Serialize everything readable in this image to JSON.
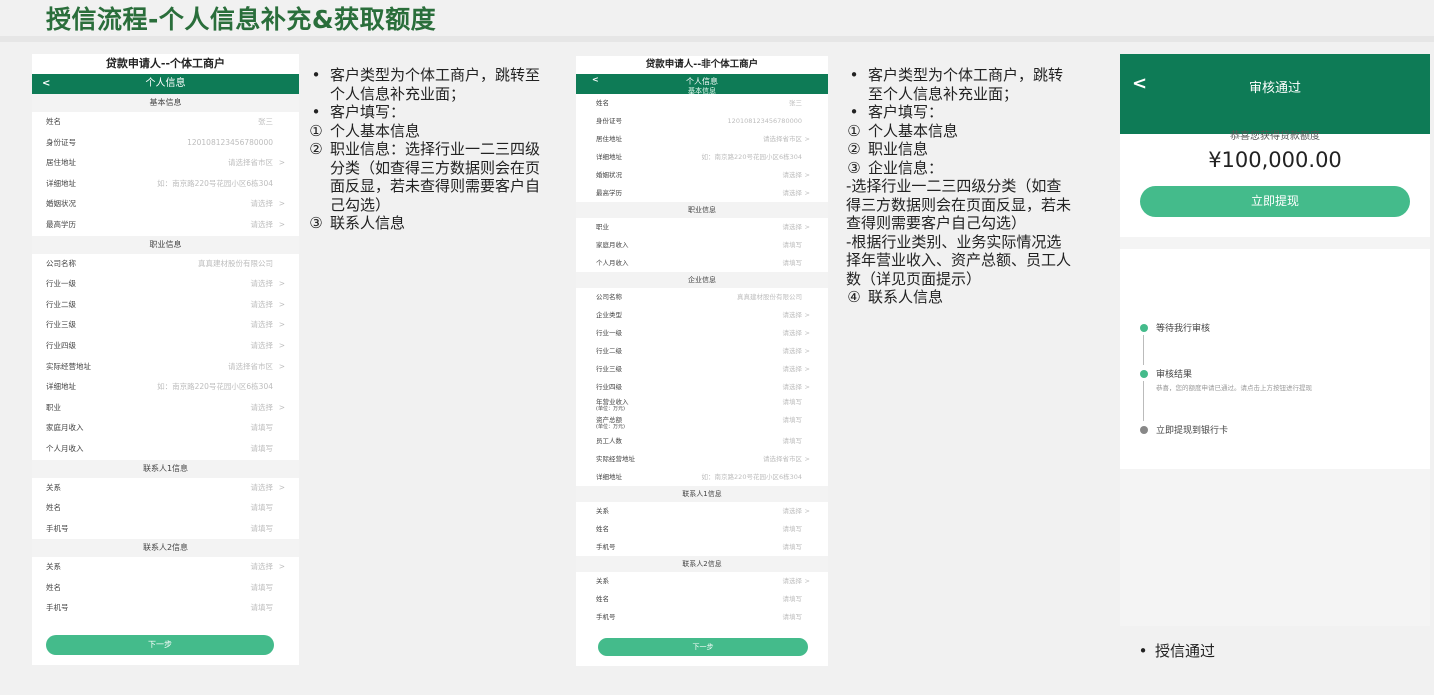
{
  "slide": {
    "title": "授信流程-个人信息补充&获取额度"
  },
  "phone1": {
    "title": "贷款申请人--个体工商户",
    "header": "个人信息",
    "back": "<",
    "sections": [
      {
        "title": "基本信息",
        "rows": [
          {
            "label": "姓名",
            "value": "张三",
            "arrow": ""
          },
          {
            "label": "身份证号",
            "value": "120108123456780000",
            "arrow": ""
          },
          {
            "label": "居住地址",
            "value": "请选择省市区",
            "arrow": ">"
          },
          {
            "label": "详细地址",
            "value": "如：南京路220号花园小区6栋304",
            "arrow": ""
          },
          {
            "label": "婚姻状况",
            "value": "请选择",
            "arrow": ">"
          },
          {
            "label": "最高学历",
            "value": "请选择",
            "arrow": ">"
          }
        ]
      },
      {
        "title": "职业信息",
        "rows": [
          {
            "label": "公司名称",
            "value": "真真建材股份有限公司",
            "arrow": ""
          },
          {
            "label": "行业一级",
            "value": "请选择",
            "arrow": ">"
          },
          {
            "label": "行业二级",
            "value": "请选择",
            "arrow": ">"
          },
          {
            "label": "行业三级",
            "value": "请选择",
            "arrow": ">"
          },
          {
            "label": "行业四级",
            "value": "请选择",
            "arrow": ">"
          },
          {
            "label": "实际经营地址",
            "value": "请选择省市区",
            "arrow": ">"
          },
          {
            "label": "详细地址",
            "value": "如：南京路220号花园小区6栋304",
            "arrow": ""
          },
          {
            "label": "职业",
            "value": "请选择",
            "arrow": ">"
          },
          {
            "label": "家庭月收入",
            "value": "请填写",
            "arrow": ""
          },
          {
            "label": "个人月收入",
            "value": "请填写",
            "arrow": ""
          }
        ]
      },
      {
        "title": "联系人1信息",
        "rows": [
          {
            "label": "关系",
            "value": "请选择",
            "arrow": ">"
          },
          {
            "label": "姓名",
            "value": "请填写",
            "arrow": ""
          },
          {
            "label": "手机号",
            "value": "请填写",
            "arrow": ""
          }
        ]
      },
      {
        "title": "联系人2信息",
        "rows": [
          {
            "label": "关系",
            "value": "请选择",
            "arrow": ">"
          },
          {
            "label": "姓名",
            "value": "请填写",
            "arrow": ""
          },
          {
            "label": "手机号",
            "value": "请填写",
            "arrow": ""
          }
        ]
      }
    ],
    "button": "下一步"
  },
  "note1": {
    "lines": [
      {
        "bullet": "•",
        "text": "客户类型为个体工商户，跳转至"
      },
      {
        "bullet": "",
        "text": "个人信息补充业面；"
      },
      {
        "bullet": "•",
        "text": "客户填写："
      },
      {
        "bullet": "①",
        "text": "个人基本信息"
      },
      {
        "bullet": "②",
        "text": "职业信息：选择行业一二三四级"
      },
      {
        "bullet": "",
        "text": "分类（如查得三方数据则会在页"
      },
      {
        "bullet": "",
        "text": "面反显，若未查得则需要客户自"
      },
      {
        "bullet": "",
        "text": "己勾选）"
      },
      {
        "bullet": "③",
        "text": "联系人信息"
      }
    ]
  },
  "phone2": {
    "title": "贷款申请人--非个体工商户",
    "header": "个人信息",
    "header_sub": "基本信息",
    "back": "<",
    "sections": [
      {
        "title": "",
        "rows": [
          {
            "label": "姓名",
            "value": "张三",
            "arrow": ""
          },
          {
            "label": "身份证号",
            "value": "120108123456780000",
            "arrow": ""
          },
          {
            "label": "居住地址",
            "value": "请选择省市区",
            "arrow": ">"
          },
          {
            "label": "详细地址",
            "value": "如：南京路220号花园小区6栋304",
            "arrow": ""
          },
          {
            "label": "婚姻状况",
            "value": "请选择",
            "arrow": ">"
          },
          {
            "label": "最高学历",
            "value": "请选择",
            "arrow": ">"
          }
        ]
      },
      {
        "title": "职业信息",
        "rows": [
          {
            "label": "职业",
            "value": "请选择",
            "arrow": ">"
          },
          {
            "label": "家庭月收入",
            "value": "请填写",
            "arrow": ""
          },
          {
            "label": "个人月收入",
            "value": "请填写",
            "arrow": ""
          }
        ]
      },
      {
        "title": "企业信息",
        "rows": [
          {
            "label": "公司名称",
            "value": "真真建材股份有限公司",
            "arrow": ""
          },
          {
            "label": "企业类型",
            "value": "请选择",
            "arrow": ">"
          },
          {
            "label": "行业一级",
            "value": "请选择",
            "arrow": ">"
          },
          {
            "label": "行业二级",
            "value": "请选择",
            "arrow": ">"
          },
          {
            "label": "行业三级",
            "value": "请选择",
            "arrow": ">"
          },
          {
            "label": "行业四级",
            "value": "请选择",
            "arrow": ">"
          },
          {
            "label": "年营业收入",
            "label2": "(单位：万元)",
            "value": "请填写",
            "arrow": ""
          },
          {
            "label": "资产总额",
            "label2": "(单位：万元)",
            "value": "请填写",
            "arrow": ""
          },
          {
            "label": "员工人数",
            "value": "请填写",
            "arrow": ""
          },
          {
            "label": "实际经营地址",
            "value": "请选择省市区",
            "arrow": ">"
          },
          {
            "label": "详细地址",
            "value": "如：南京路220号花园小区6栋304",
            "arrow": ""
          }
        ]
      },
      {
        "title": "联系人1信息",
        "rows": [
          {
            "label": "关系",
            "value": "请选择",
            "arrow": ">"
          },
          {
            "label": "姓名",
            "value": "请填写",
            "arrow": ""
          },
          {
            "label": "手机号",
            "value": "请填写",
            "arrow": ""
          }
        ]
      },
      {
        "title": "联系人2信息",
        "rows": [
          {
            "label": "关系",
            "value": "请选择",
            "arrow": ">"
          },
          {
            "label": "姓名",
            "value": "请填写",
            "arrow": ""
          },
          {
            "label": "手机号",
            "value": "请填写",
            "arrow": ""
          }
        ]
      }
    ],
    "button": "下一步"
  },
  "note2": {
    "lines": [
      {
        "bullet": "•",
        "text": "客户类型为个体工商户，跳转"
      },
      {
        "bullet": "",
        "text": "至个人信息补充业面；"
      },
      {
        "bullet": "•",
        "text": "客户填写："
      },
      {
        "bullet": "①",
        "text": "个人基本信息"
      },
      {
        "bullet": "②",
        "text": "职业信息"
      },
      {
        "bullet": "③",
        "text": "企业信息："
      },
      {
        "bullet": "",
        "text": "-选择行业一二三四级分类（如查",
        "flush": true
      },
      {
        "bullet": "",
        "text": "得三方数据则会在页面反显，若未",
        "flush": true
      },
      {
        "bullet": "",
        "text": "查得则需要客户自己勾选）",
        "flush": true
      },
      {
        "bullet": "",
        "text": "-根据行业类别、业务实际情况选",
        "flush": true
      },
      {
        "bullet": "",
        "text": "择年营业收入、资产总额、员工人",
        "flush": true
      },
      {
        "bullet": "",
        "text": "数（详见页面提示）",
        "flush": true
      },
      {
        "bullet": "④",
        "text": "联系人信息"
      }
    ]
  },
  "phone3": {
    "header": "审核通过",
    "back": "<",
    "congrats": "恭喜您获得贷款额度",
    "amount": "¥100,000.00",
    "button": "立即提现",
    "steps": [
      {
        "title": "等待我行审核",
        "desc": ""
      },
      {
        "title": "审核结果",
        "desc": "恭喜，您的额度申请已通过。请点击上方按钮进行提现"
      },
      {
        "title": "立即提现到银行卡",
        "desc": ""
      }
    ]
  },
  "note3": {
    "bullet": "•",
    "text": "授信通过"
  },
  "colors": {
    "brand": "#0e7b56",
    "button": "#44bb8b",
    "title": "#2a6e3b"
  }
}
